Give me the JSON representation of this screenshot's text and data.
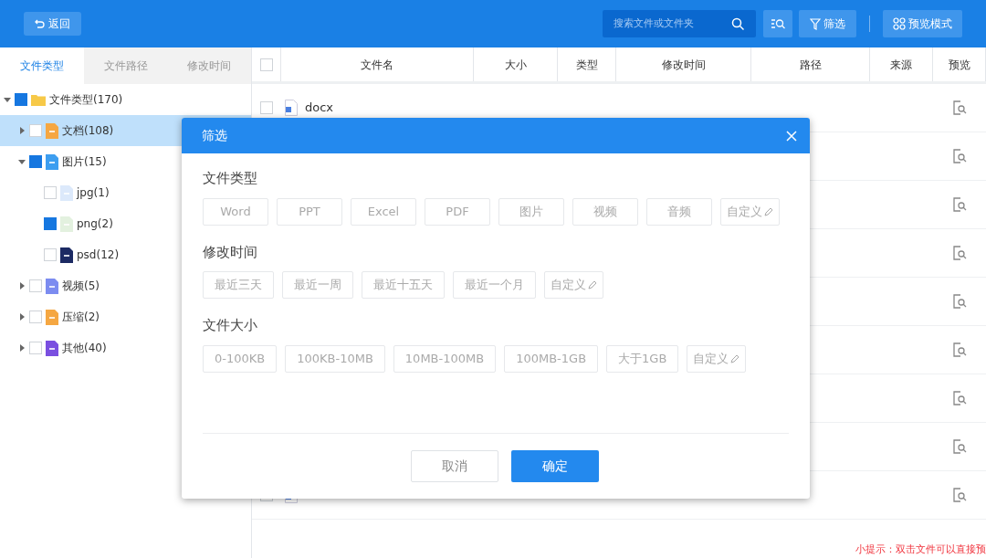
{
  "toolbar": {
    "back_button": "返回",
    "search": {
      "placeholder": "搜索文件或文件夹"
    },
    "filter_button": "筛选",
    "preview_mode_button": "预览模式"
  },
  "sidebar": {
    "tabs": [
      {
        "label": "文件类型",
        "selected": true
      },
      {
        "label": "文件路径",
        "selected": false
      },
      {
        "label": "修改时间",
        "selected": false
      }
    ],
    "tree": [
      {
        "label": "文件类型(170)",
        "kind": "folder",
        "checked": true,
        "expanded": true,
        "selected": false,
        "children": [
          {
            "label": "文档(108)",
            "kind": "doc",
            "checked": false,
            "expanded": false,
            "selected": true
          },
          {
            "label": "图片(15)",
            "kind": "image",
            "checked": true,
            "expanded": true,
            "selected": false,
            "children": [
              {
                "label": "jpg(1)",
                "kind": "jpg",
                "checked": false,
                "selected": false
              },
              {
                "label": "png(2)",
                "kind": "png",
                "checked": true,
                "selected": false
              },
              {
                "label": "psd(12)",
                "kind": "psd",
                "checked": false,
                "selected": false
              }
            ]
          },
          {
            "label": "视频(5)",
            "kind": "video",
            "checked": false,
            "expanded": false,
            "selected": false
          },
          {
            "label": "压缩(2)",
            "kind": "zip",
            "checked": false,
            "expanded": false,
            "selected": false
          },
          {
            "label": "其他(40)",
            "kind": "other",
            "checked": false,
            "expanded": false,
            "selected": false
          }
        ]
      }
    ]
  },
  "table": {
    "header_checked": false,
    "columns": [
      "文件名",
      "大小",
      "类型",
      "修改时间",
      "路径",
      "来源",
      "预览"
    ],
    "rows": [
      {
        "kind": "file",
        "name": "docx",
        "checked": false
      },
      {
        "kind": "covered"
      },
      {
        "kind": "covered"
      },
      {
        "kind": "covered"
      },
      {
        "kind": "covered"
      },
      {
        "kind": "covered"
      },
      {
        "kind": "covered"
      },
      {
        "kind": "covered"
      },
      {
        "kind": "file",
        "checked": false
      }
    ]
  },
  "dialog": {
    "title": "筛选",
    "sections": [
      {
        "title": "文件类型",
        "options": [
          {
            "label": "Word",
            "kind": "plain"
          },
          {
            "label": "PPT",
            "kind": "plain"
          },
          {
            "label": "Excel",
            "kind": "plain"
          },
          {
            "label": "PDF",
            "kind": "plain"
          },
          {
            "label": "图片",
            "kind": "plain"
          },
          {
            "label": "视频",
            "kind": "plain"
          },
          {
            "label": "音频",
            "kind": "plain"
          },
          {
            "label": "自定义",
            "kind": "custom"
          }
        ]
      },
      {
        "title": "修改时间",
        "options": [
          {
            "label": "最近三天",
            "kind": "plain"
          },
          {
            "label": "最近一周",
            "kind": "plain"
          },
          {
            "label": "最近十五天",
            "kind": "plain"
          },
          {
            "label": "最近一个月",
            "kind": "plain"
          },
          {
            "label": "自定义",
            "kind": "custom"
          }
        ]
      },
      {
        "title": "文件大小",
        "options": [
          {
            "label": "0-100KB",
            "kind": "plain"
          },
          {
            "label": "100KB-10MB",
            "kind": "plain"
          },
          {
            "label": "10MB-100MB",
            "kind": "plain"
          },
          {
            "label": "100MB-1GB",
            "kind": "plain"
          },
          {
            "label": "大于1GB",
            "kind": "plain"
          },
          {
            "label": "自定义",
            "kind": "custom"
          }
        ]
      }
    ],
    "buttons": [
      {
        "label": "取消",
        "kind": "secondary"
      },
      {
        "label": "确定",
        "kind": "primary"
      }
    ]
  },
  "hint": "小提示：双击文件可以直接预"
}
